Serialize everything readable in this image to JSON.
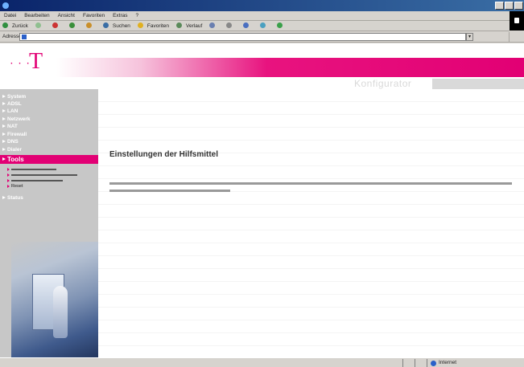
{
  "browser": {
    "title": "",
    "menu": [
      "Datei",
      "Bearbeiten",
      "Ansicht",
      "Favoriten",
      "Extras",
      "?"
    ],
    "toolbar": [
      "Zurück",
      "",
      "",
      "",
      "",
      "Suchen",
      "Favoriten",
      "Verlauf",
      "",
      "",
      "",
      "",
      ""
    ],
    "address_label": "Adresse",
    "address_value": "",
    "go_label": "",
    "links_label": "",
    "status_text": "",
    "zone_label": "Internet"
  },
  "header": {
    "logo": "T",
    "dots": "· · ·",
    "product": "",
    "config_label": "Konfigurator",
    "tabs": "",
    "brand_color": "#e20074"
  },
  "nav": {
    "items": [
      {
        "label": "System",
        "active": false
      },
      {
        "label": "ADSL",
        "active": false
      },
      {
        "label": "LAN",
        "active": false
      },
      {
        "label": "Netzwerk",
        "active": false
      },
      {
        "label": "NAT",
        "active": false
      },
      {
        "label": "Firewall",
        "active": false
      },
      {
        "label": "DNS",
        "active": false
      },
      {
        "label": "Dialer",
        "active": false
      },
      {
        "label": "Tools",
        "active": true
      },
      {
        "label": "Status",
        "active": false
      }
    ],
    "sub_items": [
      "",
      "",
      "",
      "Reset"
    ]
  },
  "content": {
    "title": "Einstellungen der Hilfsmittel",
    "text": ""
  }
}
